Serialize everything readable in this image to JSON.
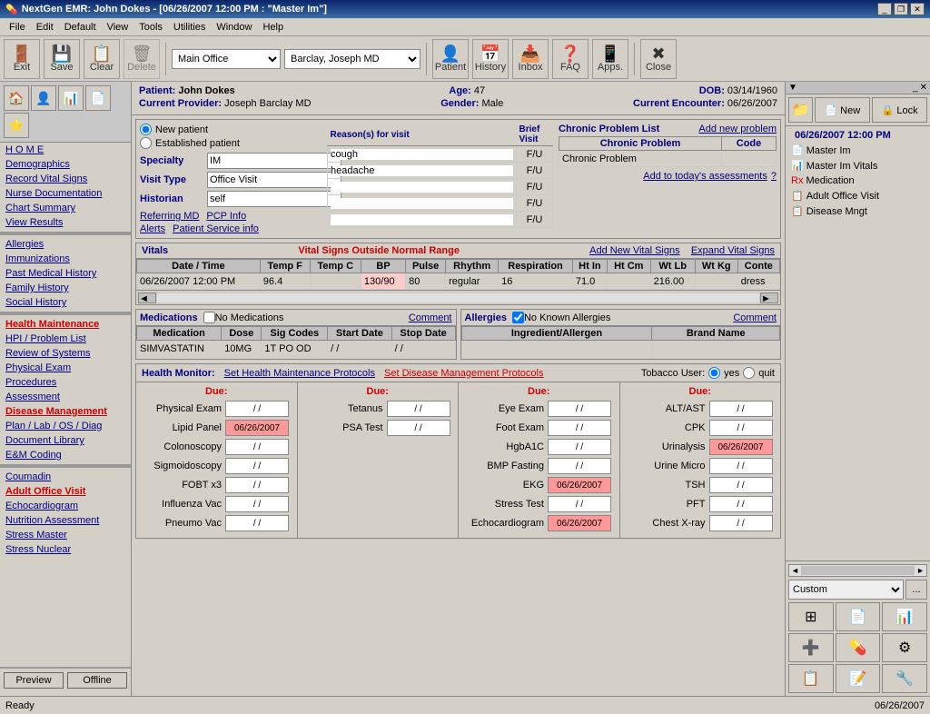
{
  "window": {
    "title": "NextGen EMR: John Dokes - [06/26/2007 12:00 PM : \"Master Im\"]",
    "title_icon": "💊"
  },
  "menu": {
    "items": [
      "File",
      "Edit",
      "Default",
      "View",
      "Tools",
      "Utilities",
      "Window",
      "Help"
    ]
  },
  "toolbar": {
    "buttons": [
      {
        "label": "Exit",
        "icon": "🚪"
      },
      {
        "label": "Save",
        "icon": "💾"
      },
      {
        "label": "Clear",
        "icon": "📋"
      },
      {
        "label": "Delete",
        "icon": "🗑"
      }
    ],
    "office_select": "Main Office",
    "provider_select": "Barclay, Joseph  MD",
    "right_buttons": [
      {
        "label": "Patient",
        "icon": "👤"
      },
      {
        "label": "History",
        "icon": "📅"
      },
      {
        "label": "Inbox",
        "icon": "📥"
      },
      {
        "label": "FAO",
        "icon": "❓"
      },
      {
        "label": "Apps.",
        "icon": "📱"
      },
      {
        "label": "Close",
        "icon": "✖"
      }
    ]
  },
  "patient": {
    "name": "John Dokes",
    "age_label": "Age:",
    "age": "47",
    "dob_label": "DOB:",
    "dob": "03/14/1960",
    "provider_label": "Current Provider:",
    "provider": "Joseph Barclay MD",
    "gender_label": "Gender:",
    "gender": "Male",
    "encounter_label": "Current Encounter:",
    "encounter": "06/26/2007"
  },
  "visit": {
    "new_patient": "New patient",
    "established_patient": "Established patient",
    "specialty_label": "Specialty",
    "specialty": "IM",
    "visit_type_label": "Visit Type",
    "visit_type": "Office Visit",
    "historian_label": "Historian",
    "historian": "self",
    "referring_md": "Referring MD",
    "pcp_info": "PCP Info",
    "alerts": "Alerts",
    "patient_service": "Patient Service info"
  },
  "reasons": {
    "header": "Reason(s) for visit",
    "brief_visit": "Brief Visit",
    "fu_label": "F/U",
    "rows": [
      {
        "reason": "cough",
        "fu": "F/U"
      },
      {
        "reason": "headache",
        "fu": "F/U"
      },
      {
        "reason": "",
        "fu": "F/U"
      },
      {
        "reason": "",
        "fu": "F/U"
      },
      {
        "reason": "",
        "fu": "F/U"
      }
    ]
  },
  "chronic": {
    "title": "Chronic Problem List",
    "add_link": "Add new problem",
    "col1": "Chronic Problem",
    "col2": "Code",
    "rows": [
      {
        "problem": "Chronic Problem",
        "code": ""
      }
    ],
    "add_assessment": "Add to today's assessments",
    "help": "?"
  },
  "vitals": {
    "title": "Vitals",
    "alert": "Vital Signs Outside Normal Range",
    "add_link": "Add New Vital Signs",
    "expand_link": "Expand Vital Signs",
    "columns": [
      "Date / Time",
      "Temp F",
      "Temp C",
      "BP",
      "Pulse",
      "Rhythm",
      "Respiration",
      "Ht In",
      "Ht Cm",
      "Wt Lb",
      "Wt Kg",
      "Conte"
    ],
    "rows": [
      {
        "date": "06/26/2007 12:00 PM",
        "tempF": "96.4",
        "tempC": "",
        "bp": "130/90",
        "pulse": "80",
        "rhythm": "regular",
        "resp": "16",
        "htIn": "71.0",
        "htCm": "",
        "wtLb": "216.00",
        "wtKg": "",
        "conte": "dress"
      }
    ]
  },
  "medications": {
    "title": "Medications",
    "no_meds_label": "No Medications",
    "comment_label": "Comment",
    "columns": [
      "Medication",
      "Dose",
      "Sig Codes",
      "Start Date",
      "Stop Date"
    ],
    "rows": [
      {
        "med": "SIMVASTATIN",
        "dose": "10MG",
        "sig": "1T PO OD",
        "start": "/ /",
        "stop": "/ /"
      }
    ]
  },
  "allergies": {
    "title": "Allergies",
    "no_allergies_label": "No Known Allergies",
    "comment_label": "Comment",
    "columns": [
      "Ingredient/Allergen",
      "Brand Name"
    ],
    "rows": []
  },
  "health_monitor": {
    "title": "Health Monitor:",
    "protocol1": "Set Health Maintenance Protocols",
    "protocol2": "Set Disease Management Protocols",
    "tobacco_label": "Tobacco User:",
    "tobacco_yes": "yes",
    "tobacco_quit": "quit",
    "col_due": "Due:",
    "columns": [
      {
        "items": [
          {
            "label": "Physical Exam",
            "value": "/ /",
            "highlight": false
          },
          {
            "label": "Lipid Panel",
            "value": "06/26/2007",
            "highlight": true
          },
          {
            "label": "Colonoscopy",
            "value": "/ /",
            "highlight": false
          },
          {
            "label": "Sigmoidoscopy",
            "value": "/ /",
            "highlight": false
          },
          {
            "label": "FOBT x3",
            "value": "/ /",
            "highlight": false
          },
          {
            "label": "Influenza Vac",
            "value": "/ /",
            "highlight": false
          },
          {
            "label": "Pneumo Vac",
            "value": "/ /",
            "highlight": false
          }
        ]
      },
      {
        "items": [
          {
            "label": "Tetanus",
            "value": "/ /",
            "highlight": false
          },
          {
            "label": "PSA Test",
            "value": "/ /",
            "highlight": false
          }
        ]
      },
      {
        "items": [
          {
            "label": "Eye Exam",
            "value": "/ /",
            "highlight": false
          },
          {
            "label": "Foot Exam",
            "value": "/ /",
            "highlight": false
          },
          {
            "label": "HgbA1C",
            "value": "/ /",
            "highlight": false
          },
          {
            "label": "BMP Fasting",
            "value": "/ /",
            "highlight": false
          },
          {
            "label": "EKG",
            "value": "06/26/2007",
            "highlight": true
          },
          {
            "label": "Stress Test",
            "value": "/ /",
            "highlight": false
          },
          {
            "label": "Echocardiogram",
            "value": "06/26/2007",
            "highlight": true
          }
        ]
      },
      {
        "items": [
          {
            "label": "ALT/AST",
            "value": "/ /",
            "highlight": false
          },
          {
            "label": "CPK",
            "value": "/ /",
            "highlight": false
          },
          {
            "label": "Urinalysis",
            "value": "06/26/2007",
            "highlight": true
          },
          {
            "label": "Urine Micro",
            "value": "/ /",
            "highlight": false
          },
          {
            "label": "TSH",
            "value": "/ /",
            "highlight": false
          },
          {
            "label": "PFT",
            "value": "/ /",
            "highlight": false
          },
          {
            "label": "Chest X-ray",
            "value": "/ /",
            "highlight": false
          }
        ]
      }
    ]
  },
  "sidebar": {
    "nav_items": [
      {
        "label": "H O M E",
        "active": false
      },
      {
        "label": "Demographics",
        "active": false
      },
      {
        "label": "Record Vital Signs",
        "active": false
      },
      {
        "label": "Nurse Documentation",
        "active": false
      },
      {
        "label": "Chart Summary",
        "active": false
      },
      {
        "label": "View Results",
        "active": false
      }
    ],
    "sections": [
      {
        "items": [
          {
            "label": "Allergies"
          },
          {
            "label": "Immunizations"
          },
          {
            "label": "Past Medical History"
          },
          {
            "label": "Family History"
          },
          {
            "label": "Social History"
          }
        ]
      }
    ],
    "active_items": [
      {
        "label": "Health Maintenance",
        "bold_red": true
      },
      {
        "label": "HPI / Problem List"
      },
      {
        "label": "Review of Systems"
      },
      {
        "label": "Physical Exam"
      },
      {
        "label": "Procedures"
      },
      {
        "label": "Assessment"
      },
      {
        "label": "Disease Management",
        "bold_red": true
      },
      {
        "label": "Plan / Lab / OS / Diag"
      },
      {
        "label": "Document Library"
      },
      {
        "label": "E&M Coding"
      }
    ],
    "bottom_section": [
      {
        "label": "Coumadin"
      },
      {
        "label": "Adult Office Visit",
        "bold": true
      },
      {
        "label": "Echocardiogram"
      },
      {
        "label": "Nutrition Assessment"
      },
      {
        "label": "Stress Master"
      },
      {
        "label": "Stress Nuclear"
      }
    ],
    "preview": "Preview",
    "offline": "Offline"
  },
  "far_right": {
    "tree_date": "06/26/2007 12:00 PM",
    "tree_items": [
      {
        "icon": "📄",
        "label": "Master Im"
      },
      {
        "icon": "📊",
        "label": "Master Im Vitals"
      },
      {
        "icon": "💊",
        "label": "Medication"
      },
      {
        "icon": "🏥",
        "label": "Adult Office Visit"
      },
      {
        "icon": "📋",
        "label": "Disease Mngt"
      }
    ],
    "custom_label": "Custom",
    "new_label": "New",
    "lock_label": "Lock"
  },
  "status_bar": {
    "status": "Ready",
    "date": "06/26/2007"
  }
}
